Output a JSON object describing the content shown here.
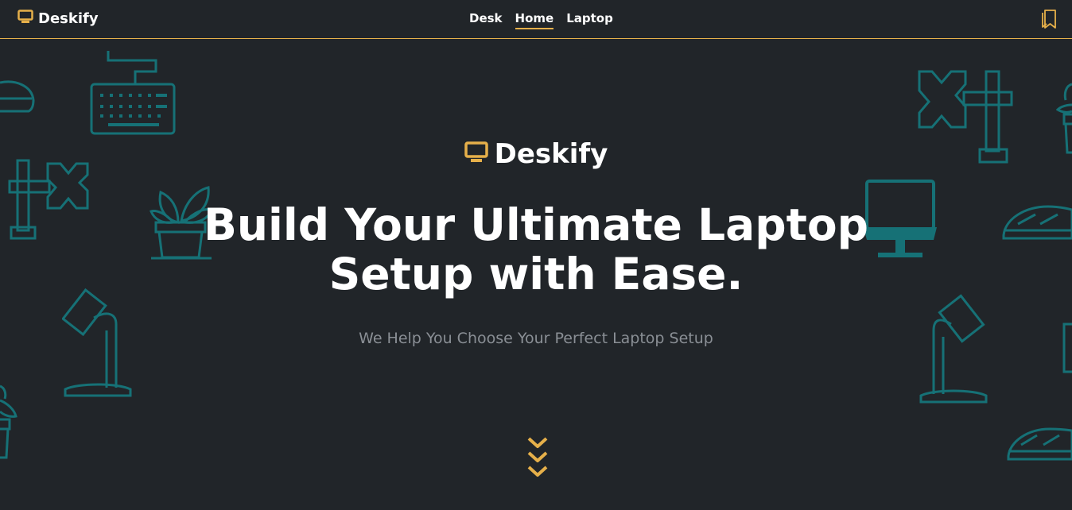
{
  "header": {
    "brand": "Deskify",
    "nav": [
      {
        "label": "Desk"
      },
      {
        "label": "Home",
        "active": true
      },
      {
        "label": "Laptop"
      }
    ],
    "bookmark_icon": "bookmark-icon"
  },
  "hero": {
    "brand": "Deskify",
    "headline_line1": "Build Your Ultimate Laptop",
    "headline_line2": "Setup with Ease.",
    "subheadline": "We Help You Choose Your Perfect Laptop Setup",
    "scroll_icon": "chevrons-down-icon"
  },
  "colors": {
    "background": "#212529",
    "accent": "#e6b04a",
    "decor": "#167176",
    "muted_text": "#8a8f95"
  }
}
